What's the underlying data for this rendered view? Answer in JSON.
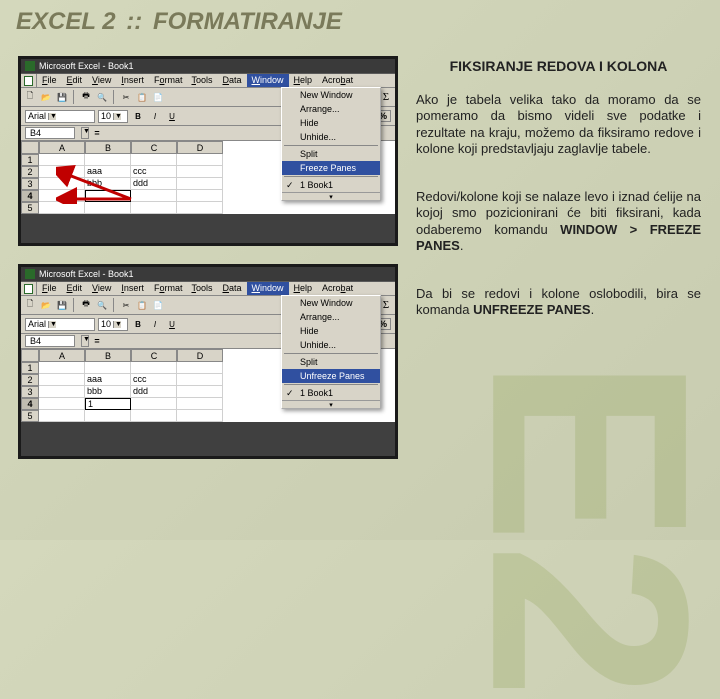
{
  "header": {
    "main": "EXCEL 2",
    "sep": "::",
    "sub": "FORMATIRANJE"
  },
  "right": {
    "title": "FIKSIRANJE REDOVA I KOLONA",
    "p1": "Ako je tabela velika tako da moramo da se pomeramo da bismo videli sve podatke i rezultate na kraju, možemo da fiksiramo redove i kolone koji predstavljaju zaglavlje tabele.",
    "p2_a": "Redovi/kolone koji se nalaze levo i iznad ćelije na kojoj smo pozicionirani će biti fiksirani, kada odaberemo komandu ",
    "p2_b": "WINDOW > FREEZE PANES",
    "p2_c": ".",
    "p3_a": "Da bi se redovi i kolone oslobodili, bira se komanda ",
    "p3_b": "UNFREEZE PANES",
    "p3_c": "."
  },
  "excel": {
    "title": "Microsoft Excel - Book1",
    "menus": [
      "File",
      "Edit",
      "View",
      "Insert",
      "Format",
      "Tools",
      "Data",
      "Window",
      "Help",
      "Acrobat"
    ],
    "font": "Arial",
    "size": "10",
    "refcell": "B4",
    "cols": [
      "A",
      "B",
      "C",
      "D"
    ],
    "rows": [
      "1",
      "2",
      "3",
      "4",
      "5"
    ],
    "cells": {
      "r2": [
        "",
        "aaa",
        "ccc",
        ""
      ],
      "r3": [
        "",
        "bbb",
        "ddd",
        ""
      ]
    },
    "sel4": {
      "row": 4,
      "col": 1,
      "val": "1"
    },
    "dd1": {
      "items": [
        "New Window",
        "Arrange...",
        "Hide",
        "Unhide...",
        "Split"
      ],
      "highlight": "Freeze Panes",
      "book": "1 Book1"
    },
    "dd2": {
      "items": [
        "New Window",
        "Arrange...",
        "Hide",
        "Unhide...",
        "Split"
      ],
      "highlight": "Unfreeze Panes",
      "book": "1 Book1"
    },
    "sigma": "Σ",
    "pct": "%"
  }
}
